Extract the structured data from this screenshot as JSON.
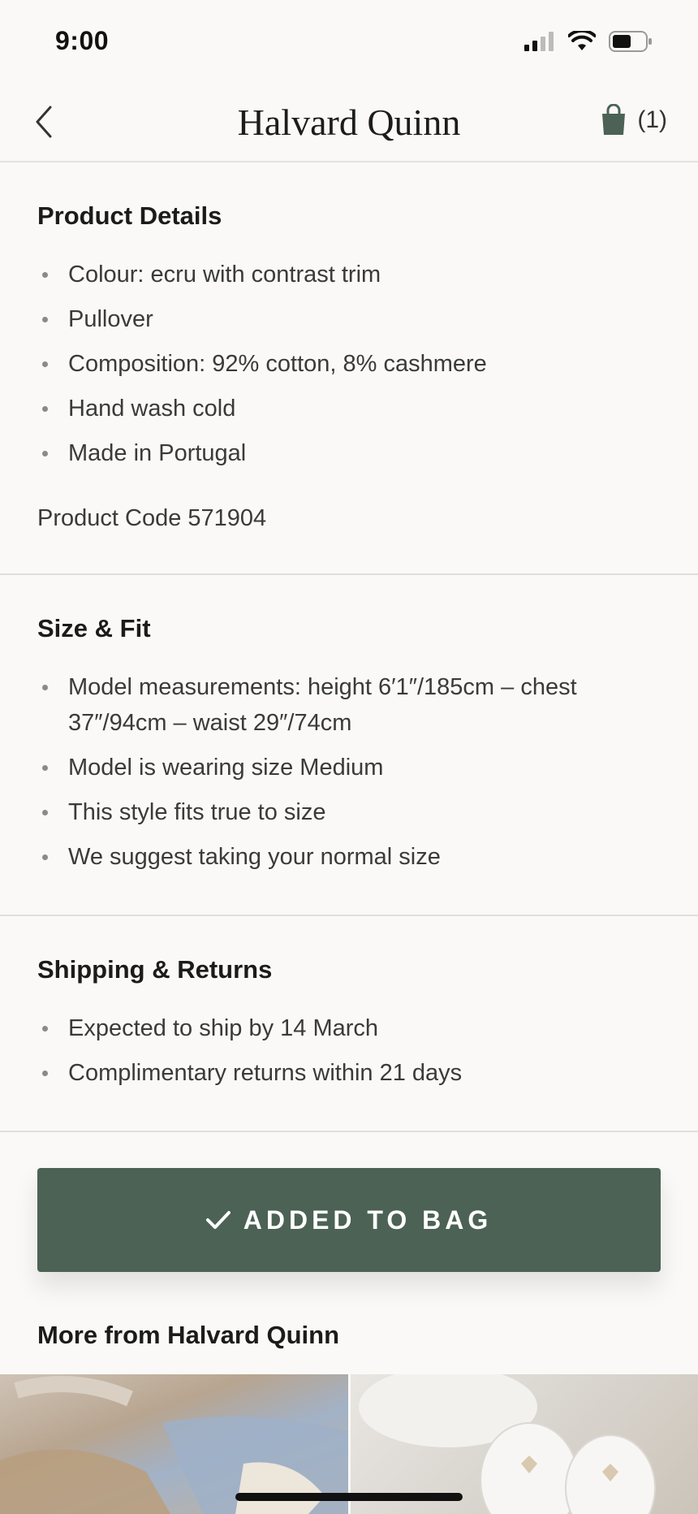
{
  "status_bar": {
    "time": "9:00"
  },
  "header": {
    "title": "Halvard Quinn",
    "bag_count": "(1)"
  },
  "product_details": {
    "heading": "Product Details",
    "items": [
      "Colour: ecru with contrast trim",
      "Pullover",
      "Composition: 92% cotton, 8% cashmere",
      "Hand wash cold",
      "Made in Portugal"
    ],
    "product_code": "Product Code 571904"
  },
  "size_fit": {
    "heading": "Size & Fit",
    "items": [
      "Model measurements: height 6′1″/185cm – chest 37″/94cm – waist 29″/74cm",
      "Model is wearing size Medium",
      "This style fits true to size",
      "We suggest taking your normal size"
    ]
  },
  "shipping_returns": {
    "heading": "Shipping & Returns",
    "items": [
      "Expected to ship by 14 March",
      "Complimentary returns within 21 days"
    ]
  },
  "cta": {
    "label": "ADDED TO BAG"
  },
  "more_from": {
    "title": "More from Halvard Quinn"
  },
  "colors": {
    "accent": "#4B6254",
    "background": "#FAF9F7"
  }
}
